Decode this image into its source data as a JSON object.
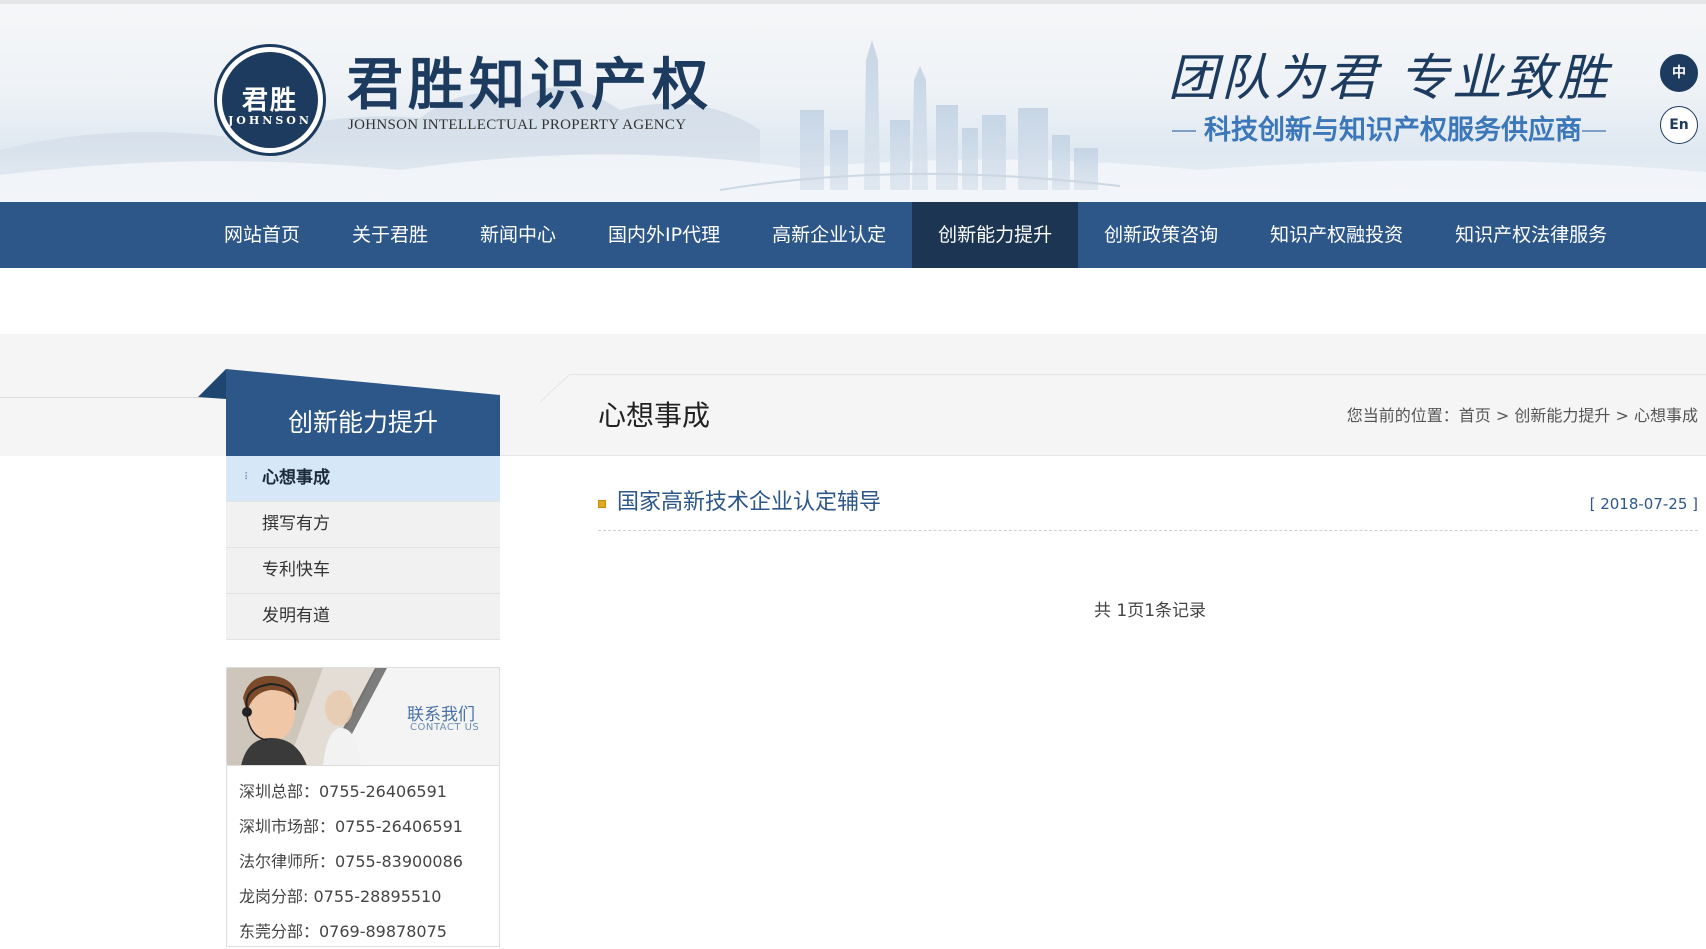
{
  "header": {
    "logo_emblem_cn": "君胜",
    "logo_emblem_en": "JOHNSON",
    "brand_name": "君胜知识产权",
    "brand_en": "JOHNSON INTELLECTUAL PROPERTY AGENCY",
    "slogan": "团队为君  专业致胜",
    "subslogan": "科技创新与知识产权服务供应商",
    "lang_cn": "中",
    "lang_en": "En"
  },
  "nav": {
    "items": [
      {
        "label": "网站首页"
      },
      {
        "label": "关于君胜"
      },
      {
        "label": "新闻中心"
      },
      {
        "label": "国内外IP代理"
      },
      {
        "label": "高新企业认定"
      },
      {
        "label": "创新能力提升",
        "active": true
      },
      {
        "label": "创新政策咨询"
      },
      {
        "label": "知识产权融投资"
      },
      {
        "label": "知识产权法律服务"
      }
    ]
  },
  "sidebar": {
    "title": "创新能力提升",
    "items": [
      {
        "label": "心想事成",
        "active": true,
        "marker": "⠇"
      },
      {
        "label": "撰写有方"
      },
      {
        "label": "专利快车"
      },
      {
        "label": "发明有道"
      }
    ],
    "contact": {
      "title_cn": "联系我们",
      "title_en": "CONTACT US",
      "lines": [
        "深圳总部：0755-26406591",
        "深圳市场部：0755-26406591",
        "法尔律师所：0755-83900086",
        "龙岗分部:  0755-28895510",
        "东莞分部：0769-89878075"
      ]
    }
  },
  "content": {
    "title": "心想事成",
    "breadcrumb": {
      "prefix": "您当前的位置：",
      "home": "首页",
      "sep": " > ",
      "section": "创新能力提升",
      "current": "心想事成"
    },
    "articles": [
      {
        "title": "国家高新技术企业认定辅导",
        "date": "[ 2018-07-25 ]"
      }
    ],
    "pagination": "共 1页1条记录"
  },
  "colors": {
    "primary": "#2c5788",
    "nav_active": "#1b3553",
    "logo_navy": "#1d3b5e",
    "subslogan_blue": "#3c77b9",
    "bullet": "#e3a817"
  }
}
